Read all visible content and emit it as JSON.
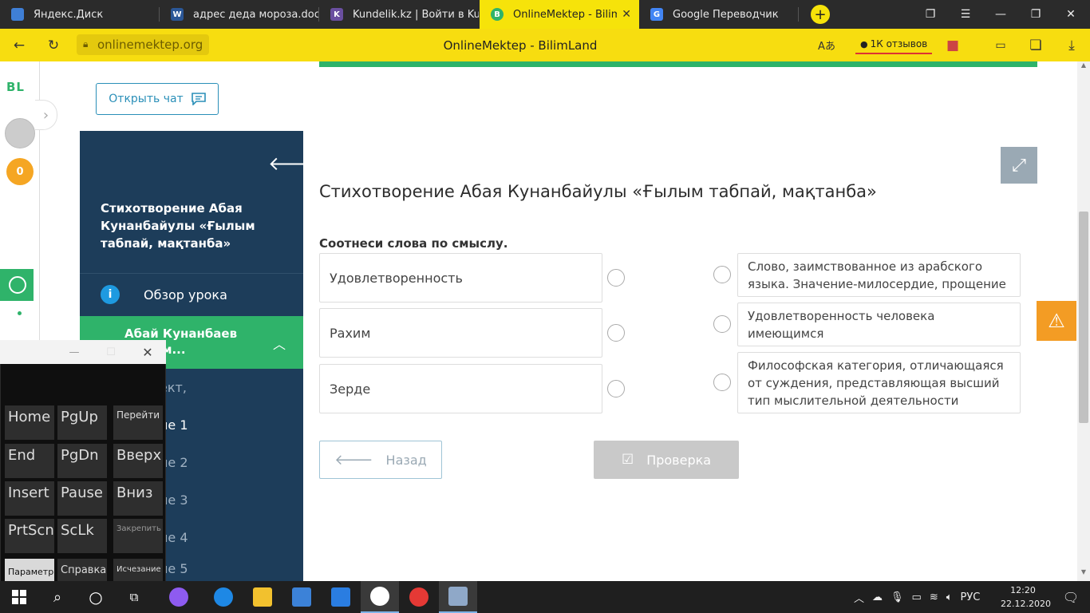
{
  "browser": {
    "tabs": [
      {
        "label": "Яндекс.Диск",
        "active": false
      },
      {
        "label": "адрес деда мороза.docx",
        "active": false
      },
      {
        "label": "Kundelik.kz | Войти в Kund",
        "active": false
      },
      {
        "label": "OnlineMektep - BilimLand",
        "active": true
      },
      {
        "label": "Google Переводчик",
        "active": false
      }
    ],
    "new_tab_label": "+",
    "url": "onlinemektep.org",
    "page_title": "OnlineMektep - BilimLand",
    "reviews_label": "1К отзывов"
  },
  "rail": {
    "logo": "BL",
    "coins": "0"
  },
  "chat_button": "Открыть чат",
  "sidebar": {
    "lesson_title": "Стихотворение Абая Кунанбайулы «Ғылым табпай, мақтанба»",
    "overview_label": "Обзор урока",
    "current_section": "Абай Кунанбаев и, не м...",
    "items": [
      "ект,",
      "ие 1",
      "ие 2",
      "ие 3",
      "ие 4",
      "ие 5"
    ]
  },
  "content": {
    "heading": "Стихотворение Абая Кунанбайулы «Ғылым табпай, мақтанба»",
    "instruction": "Соотнеси слова по смыслу.",
    "words": [
      "Удовлетворенность",
      "Рахим",
      "Зерде"
    ],
    "definitions": [
      "Слово, заимствованное из арабского языка. Значение-милосердие, прощение",
      "Удовлетворенность человека имеющимся",
      "Философская категория, отличающаяся от суждения, представляющая высший тип мыслительной деятельности"
    ],
    "back_button": "Назад",
    "check_button": "Проверка"
  },
  "keyboard": {
    "keys": [
      [
        "Home",
        "PgUp",
        "Перейти"
      ],
      [
        "End",
        "PgDn",
        "Вверх"
      ],
      [
        "Insert",
        "Pause",
        "Вниз"
      ],
      [
        "PrtScn",
        "ScLk",
        "Закрепить"
      ],
      [
        "Параметры",
        "Справка",
        "Исчезание"
      ]
    ]
  },
  "taskbar": {
    "language": "РУС",
    "time": "12:20",
    "date": "22.12.2020"
  },
  "colors": {
    "browser_accent": "#f7dd10",
    "brand_green": "#2fb36a",
    "sidebar_bg": "#1d3d5a",
    "warning": "#f39c24"
  },
  "icons": {
    "back": "arrow-left-icon",
    "reload": "reload-icon",
    "lock": "lock-icon",
    "translate": "translate-icon",
    "bookmark": "bookmark-icon",
    "battery": "battery-icon",
    "download": "download-icon",
    "chat": "chat-bubble-icon",
    "info": "info-icon",
    "expand": "expand-arrows-icon",
    "warning": "warning-triangle-icon",
    "check": "checkbox-check-icon"
  }
}
